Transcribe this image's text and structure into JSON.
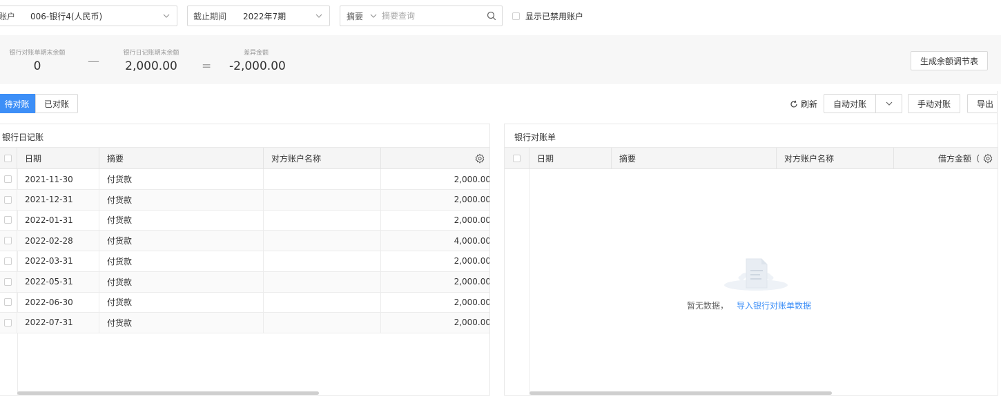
{
  "filters": {
    "account_label": "账户",
    "account_value": "006-银行4(人民币)",
    "period_label": "截止期间",
    "period_value": "2022年7期",
    "summary_select_label": "摘要",
    "search_placeholder": "摘要查询",
    "show_disabled_label": "显示已禁用账户"
  },
  "summary": {
    "bank_statement_title": "银行对账单期末余额",
    "bank_statement_value": "0",
    "minus_sign": "—",
    "journal_title": "银行日记账期末余额",
    "journal_value": "2,000.00",
    "equals_sign": "=",
    "diff_title": "差异金额",
    "diff_value": "-2,000.00",
    "generate_button": "生成余额调节表"
  },
  "tabs": {
    "pending": "待对账",
    "done": "已对账"
  },
  "toolbar": {
    "refresh": "刷新",
    "auto_reconcile": "自动对账",
    "manual_reconcile": "手动对账",
    "export": "导出"
  },
  "left_panel": {
    "title": "银行日记账",
    "columns": [
      "日期",
      "摘要",
      "对方账户名称",
      ""
    ],
    "rows": [
      {
        "date": "2021-11-30",
        "summary": "付货款",
        "counterparty": "",
        "amount": "2,000.00"
      },
      {
        "date": "2021-12-31",
        "summary": "付货款",
        "counterparty": "",
        "amount": "2,000.00"
      },
      {
        "date": "2022-01-31",
        "summary": "付货款",
        "counterparty": "",
        "amount": "2,000.00"
      },
      {
        "date": "2022-02-28",
        "summary": "付货款",
        "counterparty": "",
        "amount": "4,000.00"
      },
      {
        "date": "2022-03-31",
        "summary": "付货款",
        "counterparty": "",
        "amount": "2,000.00"
      },
      {
        "date": "2022-05-31",
        "summary": "付货款",
        "counterparty": "",
        "amount": "2,000.00"
      },
      {
        "date": "2022-06-30",
        "summary": "付货款",
        "counterparty": "",
        "amount": "2,000.00"
      },
      {
        "date": "2022-07-31",
        "summary": "付货款",
        "counterparty": "",
        "amount": "2,000.00"
      }
    ]
  },
  "right_panel": {
    "title": "银行对账单",
    "columns": [
      "日期",
      "摘要",
      "对方账户名称",
      "借方金额（"
    ],
    "empty_text": "暂无数据，",
    "import_link": "导入银行对账单数据"
  }
}
